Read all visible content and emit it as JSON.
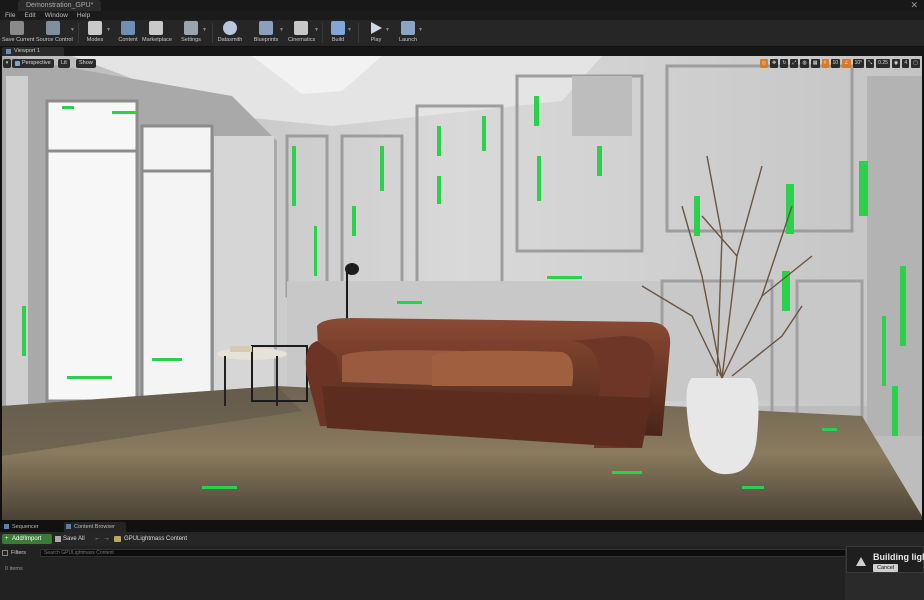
{
  "window": {
    "tab_title": "Demonstration_GPU*",
    "close": "✕"
  },
  "menu": [
    "File",
    "Edit",
    "Window",
    "Help"
  ],
  "toolbar": [
    {
      "label": "Save Current",
      "icon": "save-icon",
      "color": "#8a8a8a"
    },
    {
      "label": "Source Control",
      "icon": "source-control-icon",
      "color": "#7f8fa0"
    },
    {
      "label": "Modes",
      "icon": "modes-icon",
      "color": "#c9c9c9"
    },
    {
      "label": "Content",
      "icon": "content-icon",
      "color": "#6f8fb4"
    },
    {
      "label": "Marketplace",
      "icon": "marketplace-icon",
      "color": "#c9c9c9"
    },
    {
      "label": "Settings",
      "icon": "settings-icon",
      "color": "#9aa4ae"
    },
    {
      "label": "Datasmith",
      "icon": "datasmith-icon",
      "color": "#b8c8dc"
    },
    {
      "label": "Blueprints",
      "icon": "blueprints-icon",
      "color": "#8aa0bc"
    },
    {
      "label": "Cinematics",
      "icon": "cinematics-icon",
      "color": "#c9c9c9"
    },
    {
      "label": "Build",
      "icon": "build-icon",
      "color": "#7fa8d8"
    },
    {
      "label": "Play",
      "icon": "play-icon",
      "color": "#cfd8e4"
    },
    {
      "label": "Launch",
      "icon": "launch-icon",
      "color": "#8aa4c6"
    }
  ],
  "viewport_tab": "Viewport 1",
  "viewport_controls": {
    "perspective": "Perspective",
    "lit": "Lit",
    "show": "Show"
  },
  "viewport_right": {
    "grid_snap": "10",
    "rotation_snap": "10°",
    "scale_snap": "0.25",
    "camera_speed": "4"
  },
  "bottom_tabs": [
    "Sequencer",
    "Content Browser"
  ],
  "content_browser": {
    "add_import": "Add/Import",
    "save_all": "Save All",
    "path": "GPULightmass Content",
    "filters": "Filters",
    "search_placeholder": "Search GPULightmass Content",
    "item_count": "0 items"
  },
  "notification": {
    "message": "Building light",
    "cancel": "Cancel"
  }
}
